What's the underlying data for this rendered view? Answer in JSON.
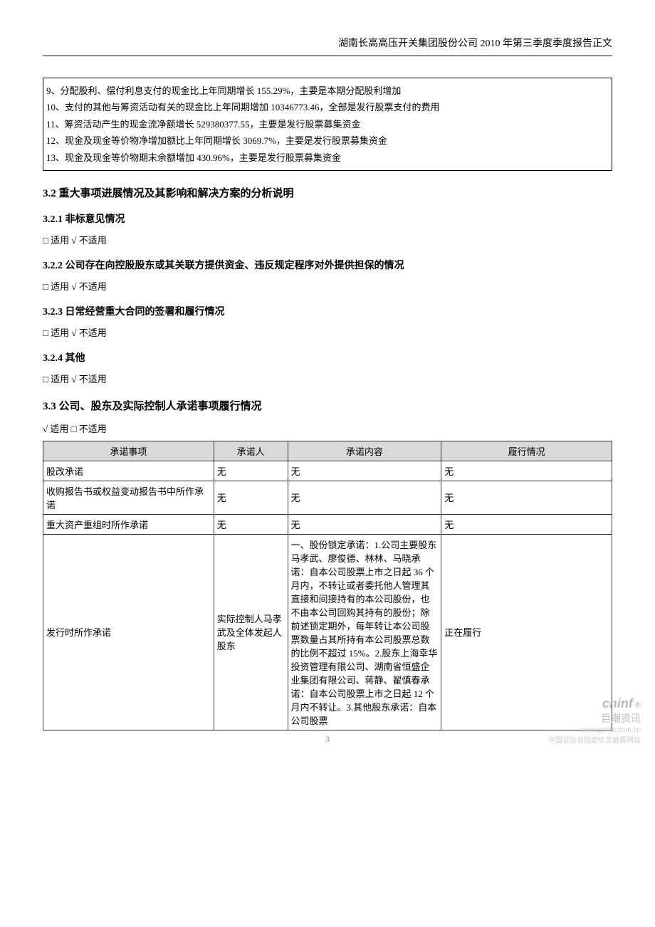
{
  "header": {
    "title": "湖南长高高压开关集团股份公司 2010 年第三季度季度报告正文"
  },
  "box_lines": [
    "9、分配股利、偿付利息支付的现金比上年同期增长 155.29%，主要是本期分配股利增加",
    "10、支付的其他与筹资活动有关的现金比上年同期增加 10346773.46，全部是发行股票支付的费用",
    "11、筹资活动产生的现金流净额增长 529380377.55，主要是发行股票募集资金",
    "12、现金及现金等价物净增加额比上年同期增长 3069.7%，主要是发行股票募集资金",
    "13、现金及现金等价物期末余额增加 430.96%，主要是发行股票募集资金"
  ],
  "sections": {
    "s32": "3.2 重大事项进展情况及其影响和解决方案的分析说明",
    "s321": "3.2.1 非标意见情况",
    "s322": "3.2.2 公司存在向控股股东或其关联方提供资金、违反规定程序对外提供担保的情况",
    "s323": "3.2.3 日常经营重大合同的签署和履行情况",
    "s324": "3.2.4 其他",
    "s33": "3.3 公司、股东及实际控制人承诺事项履行情况"
  },
  "applicable": {
    "not_applicable": "□ 适用 √ 不适用",
    "applicable": "√ 适用 □ 不适用"
  },
  "table": {
    "headers": [
      "承诺事项",
      "承诺人",
      "承诺内容",
      "履行情况"
    ],
    "rows": [
      {
        "c1": "股改承诺",
        "c2": "无",
        "c3": "无",
        "c4": "无"
      },
      {
        "c1": "收购报告书或权益变动报告书中所作承诺",
        "c2": "无",
        "c3": "无",
        "c4": "无"
      },
      {
        "c1": "重大资产重组时所作承诺",
        "c2": "无",
        "c3": "无",
        "c4": "无"
      },
      {
        "c1": "发行时所作承诺",
        "c2": "实际控制人马孝武及全体发起人股东",
        "c3": "一、股份锁定承诺：1.公司主要股东马孝武、廖俊德、林林、马晓承诺：自本公司股票上市之日起 36 个月内，不转让或者委托他人管理其直接和间接持有的本公司股份，也不由本公司回购其持有的股份；除前述锁定期外，每年转让本公司股票数量占其所持有本公司股票总数的比例不超过 15%。2.股东上海幸华投资管理有限公司、湖南省恒盛企业集团有限公司、蒋静、翟慎春承诺：自本公司股票上市之日起 12 个月内不转让。3.其他股东承诺：自本公司股票",
        "c4": "正在履行"
      }
    ]
  },
  "footer": {
    "logo_text": "cninf",
    "logo_ch": "巨潮资讯",
    "url": "www.cninfo.com.cn",
    "desc": "中国证监会指定信息披露网站",
    "page": "3"
  }
}
